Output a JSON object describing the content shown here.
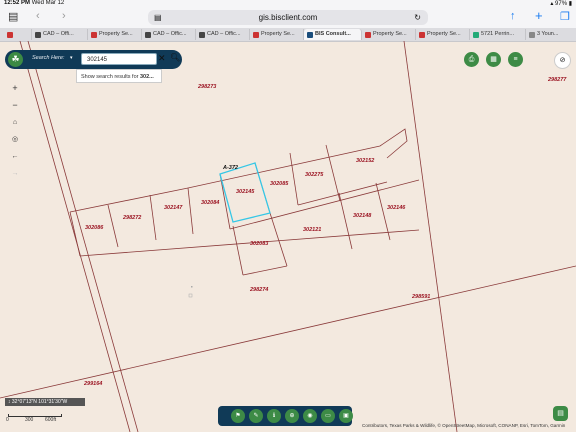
{
  "statusbar": {
    "time": "12:52 PM",
    "date": "Wed Mar 12",
    "battery": "97%"
  },
  "browser": {
    "url": "gis.bisclient.com",
    "tabs": [
      {
        "label": ""
      },
      {
        "label": "CAD – Offi..."
      },
      {
        "label": "Property Se..."
      },
      {
        "label": "CAD – Offic..."
      },
      {
        "label": "CAD – Offic..."
      },
      {
        "label": "Property Se..."
      },
      {
        "label": "BIS Consult..."
      },
      {
        "label": "Property Se..."
      },
      {
        "label": "Property Se..."
      },
      {
        "label": "5721 Perrin..."
      },
      {
        "label": "3 Youn..."
      }
    ]
  },
  "search": {
    "placeholder_label": "Search Here:",
    "value": "302145",
    "suggestion_prefix": "Show search results for ",
    "suggestion_term": "302..."
  },
  "map": {
    "parcels": [
      "298273",
      "298277",
      "302152",
      "A-372",
      "302275",
      "302145",
      "302085",
      "302147",
      "302084",
      "302148",
      "302146",
      "302086",
      "298272",
      "302121",
      "302083",
      "298274",
      "298591",
      "299164"
    ],
    "highlight_color": "#35c7e6",
    "parcel_label_color": "#9b1422"
  },
  "scale": {
    "coords": "32°07'13\"N 101°31'30\"W",
    "ticks": [
      "0",
      "300",
      "600ft"
    ]
  },
  "attribution": "Contributors, Texas Parks & Wildlife, © OpenStreetMap, Microsoft, CONANP, Esri, TomTom, Garmin"
}
